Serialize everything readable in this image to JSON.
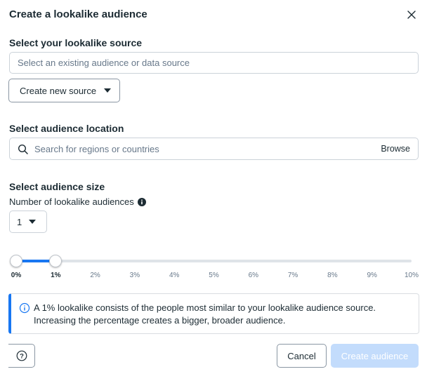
{
  "dialog": {
    "title": "Create a lookalike audience"
  },
  "source": {
    "label": "Select your lookalike source",
    "placeholder": "Select an existing audience or data source",
    "create_button_label": "Create new source"
  },
  "location": {
    "label": "Select audience location",
    "placeholder": "Search for regions or countries",
    "browse_label": "Browse"
  },
  "size": {
    "label": "Select audience size",
    "count_label": "Number of lookalike audiences",
    "count_value": "1",
    "slider": {
      "min_percent": 0,
      "max_percent": 10,
      "selected_start": 0,
      "selected_end": 1,
      "ticks": [
        "0%",
        "1%",
        "2%",
        "3%",
        "4%",
        "5%",
        "6%",
        "7%",
        "8%",
        "9%",
        "10%"
      ]
    }
  },
  "info": {
    "line1": "A 1% lookalike consists of the people most similar to your lookalike audience source.",
    "line2": "Increasing the percentage creates a bigger, broader audience."
  },
  "footer": {
    "cancel_label": "Cancel",
    "create_label": "Create audience"
  },
  "colors": {
    "accent": "#1877f2",
    "disabled_button": "#c3dcfc",
    "text": "#1c2b33"
  },
  "icons": {
    "close": "close-icon",
    "caret": "caret-down-icon",
    "search": "search-icon",
    "info": "info-icon",
    "help": "question-mark-icon"
  }
}
